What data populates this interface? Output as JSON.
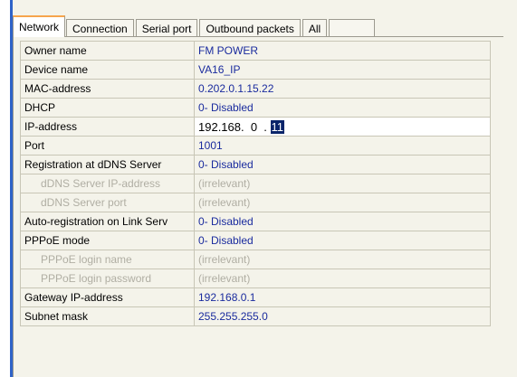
{
  "tabs": [
    {
      "label": "Network",
      "active": true
    },
    {
      "label": "Connection",
      "active": false
    },
    {
      "label": "Serial port",
      "active": false
    },
    {
      "label": "Outbound packets",
      "active": false
    },
    {
      "label": "All",
      "active": false
    }
  ],
  "rows": [
    {
      "name": "Owner name",
      "value": "FM POWER"
    },
    {
      "name": "Device name",
      "value": "VA16_IP"
    },
    {
      "name": "MAC-address",
      "value": "0.202.0.1.15.22"
    },
    {
      "name": "DHCP",
      "value": "0- Disabled"
    },
    {
      "name": "IP-address",
      "value_prefix": "192.168.  0  .",
      "value_selected": "11"
    },
    {
      "name": "Port",
      "value": "1001"
    },
    {
      "name": "Registration at dDNS Server",
      "value": "0- Disabled"
    },
    {
      "name": "dDNS Server IP-address",
      "value": "(irrelevant)"
    },
    {
      "name": "dDNS Server port",
      "value": "(irrelevant)"
    },
    {
      "name": "Auto-registration on Link Serv",
      "value": "0- Disabled"
    },
    {
      "name": "PPPoE mode",
      "value": "0- Disabled"
    },
    {
      "name": "PPPoE login name",
      "value": "(irrelevant)"
    },
    {
      "name": "PPPoE login password",
      "value": "(irrelevant)"
    },
    {
      "name": "Gateway IP-address",
      "value": "192.168.0.1"
    },
    {
      "name": "Subnet mask",
      "value": "255.255.255.0"
    }
  ]
}
